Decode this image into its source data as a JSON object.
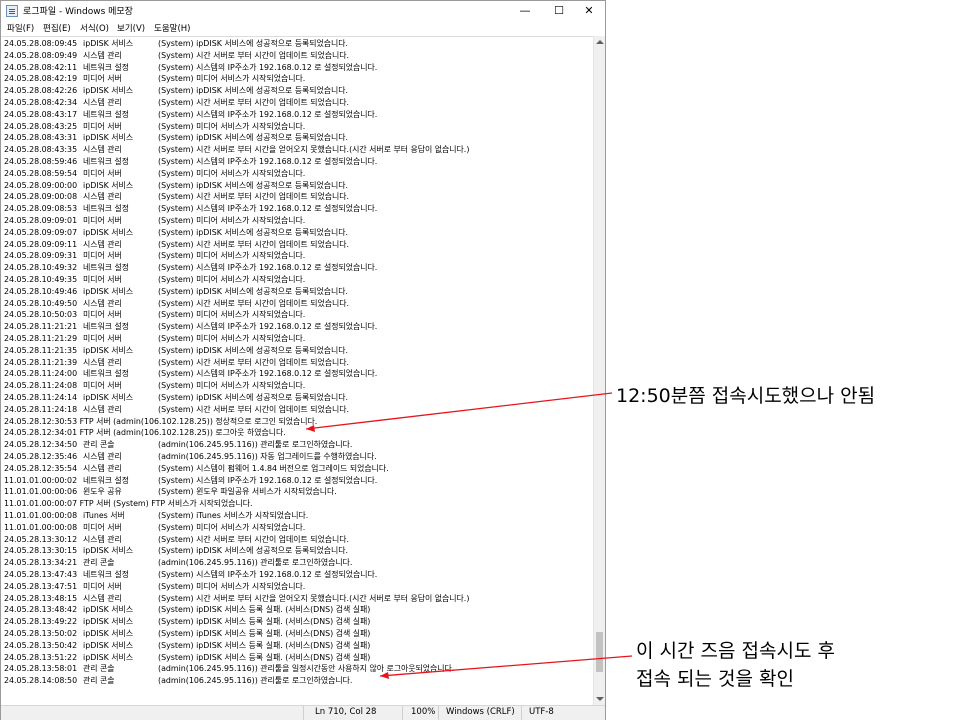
{
  "window": {
    "title": "로그파일 - Windows 메모장",
    "icon": "notepad-icon",
    "controls": {
      "minimize": "—",
      "maximize": "☐",
      "close": "✕"
    }
  },
  "menu": [
    "파일(F)",
    "편집(E)",
    "서식(O)",
    "보기(V)",
    "도움말(H)"
  ],
  "log_lines": [
    {
      "ts": "24.05.28.08:09:45",
      "svc": "ipDISK 서비스",
      "msg": "(System) ipDISK 서비스에 성공적으로 등록되었습니다."
    },
    {
      "ts": "24.05.28.08:09:49",
      "svc": "시스템 관리",
      "msg": "(System) 시간 서버로 부터 시간이 업데이트 되었습니다."
    },
    {
      "ts": "24.05.28.08:42:11",
      "svc": "네트워크 설정",
      "msg": "(System) 시스템의 IP주소가 192.168.0.12 로 설정되었습니다."
    },
    {
      "ts": "24.05.28.08:42:19",
      "svc": "미디어 서버",
      "msg": "(System) 미디어 서비스가 시작되었습니다."
    },
    {
      "ts": "24.05.28.08:42:26",
      "svc": "ipDISK 서비스",
      "msg": "(System) ipDISK 서비스에 성공적으로 등록되었습니다."
    },
    {
      "ts": "24.05.28.08:42:34",
      "svc": "시스템 관리",
      "msg": "(System) 시간 서버로 부터 시간이 업데이트 되었습니다."
    },
    {
      "ts": "24.05.28.08:43:17",
      "svc": "네트워크 설정",
      "msg": "(System) 시스템의 IP주소가 192.168.0.12 로 설정되었습니다."
    },
    {
      "ts": "24.05.28.08:43:25",
      "svc": "미디어 서버",
      "msg": "(System) 미디어 서비스가 시작되었습니다."
    },
    {
      "ts": "24.05.28.08:43:31",
      "svc": "ipDISK 서비스",
      "msg": "(System) ipDISK 서비스에 성공적으로 등록되었습니다."
    },
    {
      "ts": "24.05.28.08:43:35",
      "svc": "시스템 관리",
      "msg": "(System) 시간 서버로 부터 시간을 얻어오지 못했습니다.(시간 서버로 부터 응답이 없습니다.)"
    },
    {
      "ts": "24.05.28.08:59:46",
      "svc": "네트워크 설정",
      "msg": "(System) 시스템의 IP주소가 192.168.0.12 로 설정되었습니다."
    },
    {
      "ts": "24.05.28.08:59:54",
      "svc": "미디어 서버",
      "msg": "(System) 미디어 서비스가 시작되었습니다."
    },
    {
      "ts": "24.05.28.09:00:00",
      "svc": "ipDISK 서비스",
      "msg": "(System) ipDISK 서비스에 성공적으로 등록되었습니다."
    },
    {
      "ts": "24.05.28.09:00:08",
      "svc": "시스템 관리",
      "msg": "(System) 시간 서버로 부터 시간이 업데이트 되었습니다."
    },
    {
      "ts": "24.05.28.09:08:53",
      "svc": "네트워크 설정",
      "msg": "(System) 시스템의 IP주소가 192.168.0.12 로 설정되었습니다."
    },
    {
      "ts": "24.05.28.09:09:01",
      "svc": "미디어 서버",
      "msg": "(System) 미디어 서비스가 시작되었습니다."
    },
    {
      "ts": "24.05.28.09:09:07",
      "svc": "ipDISK 서비스",
      "msg": "(System) ipDISK 서비스에 성공적으로 등록되었습니다."
    },
    {
      "ts": "24.05.28.09:09:11",
      "svc": "시스템 관리",
      "msg": "(System) 시간 서버로 부터 시간이 업데이트 되었습니다."
    },
    {
      "ts": "24.05.28.09:09:31",
      "svc": "미디어 서버",
      "msg": "(System) 미디어 서비스가 시작되었습니다."
    },
    {
      "ts": "24.05.28.10:49:32",
      "svc": "네트워크 설정",
      "msg": "(System) 시스템의 IP주소가 192.168.0.12 로 설정되었습니다."
    },
    {
      "ts": "24.05.28.10:49:35",
      "svc": "미디어 서버",
      "msg": "(System) 미디어 서비스가 시작되었습니다."
    },
    {
      "ts": "24.05.28.10:49:46",
      "svc": "ipDISK 서비스",
      "msg": "(System) ipDISK 서비스에 성공적으로 등록되었습니다."
    },
    {
      "ts": "24.05.28.10:49:50",
      "svc": "시스템 관리",
      "msg": "(System) 시간 서버로 부터 시간이 업데이트 되었습니다."
    },
    {
      "ts": "24.05.28.10:50:03",
      "svc": "미디어 서버",
      "msg": "(System) 미디어 서비스가 시작되었습니다."
    },
    {
      "ts": "24.05.28.11:21:21",
      "svc": "네트워크 설정",
      "msg": "(System) 시스템의 IP주소가 192.168.0.12 로 설정되었습니다."
    },
    {
      "ts": "24.05.28.11:21:29",
      "svc": "미디어 서버",
      "msg": "(System) 미디어 서비스가 시작되었습니다."
    },
    {
      "ts": "24.05.28.11:21:35",
      "svc": "ipDISK 서비스",
      "msg": "(System) ipDISK 서비스에 성공적으로 등록되었습니다."
    },
    {
      "ts": "24.05.28.11:21:39",
      "svc": "시스템 관리",
      "msg": "(System) 시간 서버로 부터 시간이 업데이트 되었습니다."
    },
    {
      "ts": "24.05.28.11:24:00",
      "svc": "네트워크 설정",
      "msg": "(System) 시스템의 IP주소가 192.168.0.12 로 설정되었습니다."
    },
    {
      "ts": "24.05.28.11:24:08",
      "svc": "미디어 서버",
      "msg": "(System) 미디어 서비스가 시작되었습니다."
    },
    {
      "ts": "24.05.28.11:24:14",
      "svc": "ipDISK 서비스",
      "msg": "(System) ipDISK 서비스에 성공적으로 등록되었습니다."
    },
    {
      "ts": "24.05.28.11:24:18",
      "svc": "시스템 관리",
      "msg": "(System) 시간 서버로 부터 시간이 업데이트 되었습니다."
    },
    {
      "flat": "24.05.28.12:30:53 FTP 서버 (admin(106.102.128.25)) 정상적으로 로그인 되었습니다."
    },
    {
      "flat": "24.05.28.12:34:01 FTP 서버 (admin(106.102.128.25)) 로그아웃 하였습니다."
    },
    {
      "ts": "24.05.28.12:34:50",
      "svc": "관리 콘솔",
      "msg": "(admin(106.245.95.116)) 관리툴로 로그인하였습니다."
    },
    {
      "ts": "24.05.28.12:35:46",
      "svc": "시스템 관리",
      "msg": "(admin(106.245.95.116)) 자동 업그레이드를 수행하였습니다."
    },
    {
      "ts": "24.05.28.12:35:54",
      "svc": "시스템 관리",
      "msg": "(System) 시스템이 펌웨어 1.4.84 버전으로 업그레이드 되었습니다."
    },
    {
      "ts": "11.01.01.00:00:02",
      "svc": "네트워크 설정",
      "msg": "(System) 시스템의 IP주소가 192.168.0.12 로 설정되었습니다."
    },
    {
      "ts": "11.01.01.00:00:06",
      "svc": "윈도우 공유",
      "msg": "(System) 윈도우 파일공유 서비스가 시작되었습니다."
    },
    {
      "flat": "11.01.01.00:00:07 FTP 서버 (System) FTP 서비스가 시작되었습니다."
    },
    {
      "ts": "11.01.01.00:00:08",
      "svc": "iTunes 서버",
      "msg": "(System) iTunes 서비스가 시작되었습니다."
    },
    {
      "ts": "11.01.01.00:00:08",
      "svc": "미디어 서버",
      "msg": "(System) 미디어 서비스가 시작되었습니다."
    },
    {
      "ts": "24.05.28.13:30:12",
      "svc": "시스템 관리",
      "msg": "(System) 시간 서버로 부터 시간이 업데이트 되었습니다."
    },
    {
      "ts": "24.05.28.13:30:15",
      "svc": "ipDISK 서비스",
      "msg": "(System) ipDISK 서비스에 성공적으로 등록되었습니다."
    },
    {
      "ts": "24.05.28.13:34:21",
      "svc": "관리 콘솔",
      "msg": "(admin(106.245.95.116)) 관리툴로 로그인하였습니다."
    },
    {
      "ts": "24.05.28.13:47:43",
      "svc": "네트워크 설정",
      "msg": "(System) 시스템의 IP주소가 192.168.0.12 로 설정되었습니다."
    },
    {
      "ts": "24.05.28.13:47:51",
      "svc": "미디어 서버",
      "msg": "(System) 미디어 서비스가 시작되었습니다."
    },
    {
      "ts": "24.05.28.13:48:15",
      "svc": "시스템 관리",
      "msg": "(System) 시간 서버로 부터 시간을 얻어오지 못했습니다.(시간 서버로 부터 응답이 없습니다.)"
    },
    {
      "ts": "24.05.28.13:48:42",
      "svc": "ipDISK 서비스",
      "msg": "(System) ipDISK 서비스 등록 실패. (서비스(DNS) 검색 실패)"
    },
    {
      "ts": "24.05.28.13:49:22",
      "svc": "ipDISK 서비스",
      "msg": "(System) ipDISK 서비스 등록 실패. (서비스(DNS) 검색 실패)"
    },
    {
      "ts": "24.05.28.13:50:02",
      "svc": "ipDISK 서비스",
      "msg": "(System) ipDISK 서비스 등록 실패. (서비스(DNS) 검색 실패)"
    },
    {
      "ts": "24.05.28.13:50:42",
      "svc": "ipDISK 서비스",
      "msg": "(System) ipDISK 서비스 등록 실패. (서비스(DNS) 검색 실패)"
    },
    {
      "ts": "24.05.28.13:51:22",
      "svc": "ipDISK 서비스",
      "msg": "(System) ipDISK 서비스 등록 실패. (서비스(DNS) 검색 실패)"
    },
    {
      "ts": "24.05.28.13:58:01",
      "svc": "관리 콘솔",
      "msg": "(admin(106.245.95.116)) 관리툴을 일정시간동안 사용하지 않아 로그아웃되었습니다."
    },
    {
      "ts": "24.05.28.14:08:50",
      "svc": "관리 콘솔",
      "msg": "(admin(106.245.95.116)) 관리툴로 로그인하였습니다."
    }
  ],
  "statusbar": {
    "position": "Ln 710, Col 28",
    "zoom": "100%",
    "line_ending": "Windows (CRLF)",
    "encoding": "UTF-8"
  },
  "annotations": [
    {
      "text": "12:50분쯤 접속시도했으나 안됨"
    },
    {
      "text": "이 시간 즈음 접속시도 후"
    },
    {
      "text": "접속 되는 것을 확인"
    }
  ],
  "colors": {
    "arrow": "#e8141c",
    "window_border": "#9a9a9a"
  }
}
